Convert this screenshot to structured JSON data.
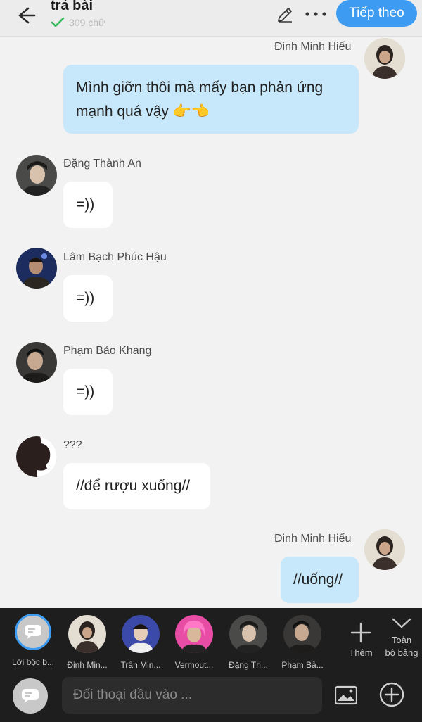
{
  "header": {
    "title": "trả bài",
    "word_count": "309 chữ",
    "next_label": "Tiếp theo",
    "accent": "#3d9cf2"
  },
  "messages": [
    {
      "sender": "Đinh Minh Hiếu",
      "text_line1": "Mình giỡn thôi mà mấy bạn phản ứng",
      "text_line2": "mạnh quá vậy 👉👈",
      "side": "right"
    },
    {
      "sender": "Đặng Thành An",
      "text": "=))",
      "side": "left"
    },
    {
      "sender": "Lâm Bạch Phúc Hậu",
      "text": "=))",
      "side": "left"
    },
    {
      "sender": "Phạm Bảo Khang",
      "text": "=))",
      "side": "left"
    },
    {
      "sender": "???",
      "text": "//để rượu xuống//",
      "side": "left"
    },
    {
      "sender": "Đinh Minh Hiếu",
      "text": "//uống//",
      "side": "right"
    }
  ],
  "characters": [
    {
      "label": "Lời bộc b..."
    },
    {
      "label": "Đinh Min..."
    },
    {
      "label": "Trần Min..."
    },
    {
      "label": "Vermout..."
    },
    {
      "label": "Đặng Th..."
    },
    {
      "label": "Phạm Bả..."
    }
  ],
  "toolbar": {
    "add_label": "Thêm",
    "expand_label_1": "Toàn",
    "expand_label_2": "bộ bảng"
  },
  "input": {
    "placeholder": "Đối thoại đầu vào ..."
  },
  "icons": [
    "back-arrow-icon",
    "check-icon",
    "pencil-icon",
    "more-icon",
    "chat-bubble-icon",
    "image-icon",
    "plus-circle-icon",
    "chevron-down-icon"
  ]
}
